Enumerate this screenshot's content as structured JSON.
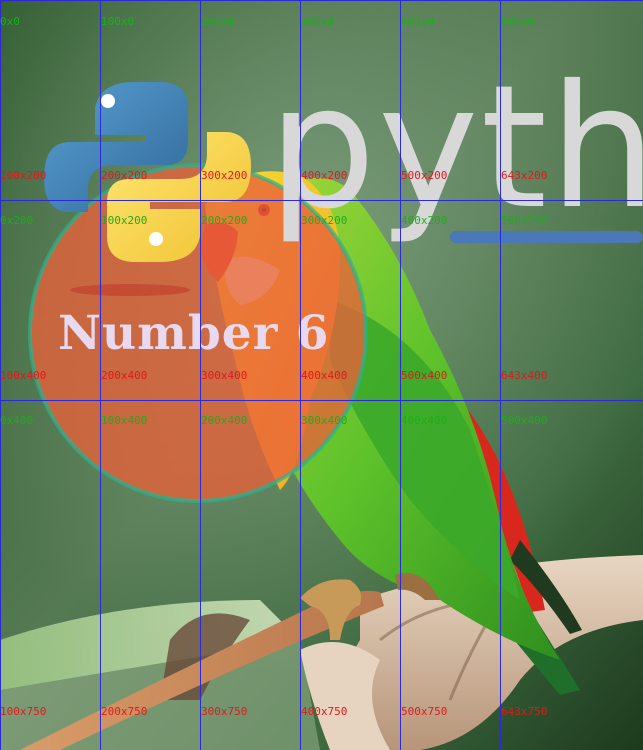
{
  "image": {
    "logo_text": "pytho",
    "overlay_text": "Number 6",
    "colors": {
      "python_blue": "#3f7ab5",
      "python_yellow": "#f6cf3e",
      "circle_fill": "#e8603a",
      "circle_ring": "#27b38e",
      "grid": "#2b2bd6",
      "label_green": "#19b019",
      "label_red": "#e01a1a"
    }
  },
  "grid_labels": {
    "green": [
      "0x0",
      "100x0",
      "200x0",
      "300x0",
      "400x0",
      "500x0",
      "0x200",
      "100x200",
      "200x200",
      "300x200",
      "400x200",
      "500x200",
      "0x400",
      "100x400",
      "200x400",
      "300x400",
      "400x400",
      "500x400"
    ],
    "red": [
      "100x200",
      "200x200",
      "300x200",
      "400x200",
      "500x200",
      "643x200",
      "100x400",
      "200x400",
      "300x400",
      "400x400",
      "500x400",
      "643x400",
      "100x750",
      "200x750",
      "300x750",
      "400x750",
      "500x750",
      "643x750"
    ]
  }
}
